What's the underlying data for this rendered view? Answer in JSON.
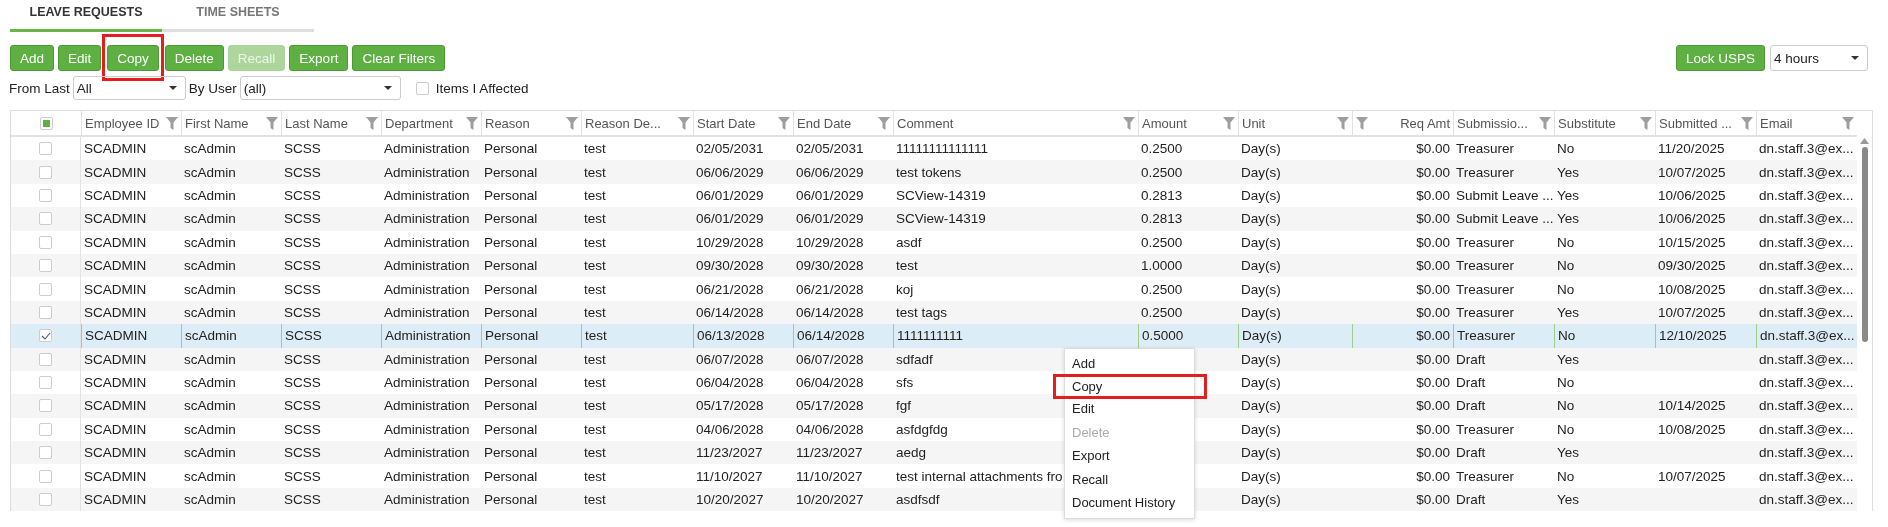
{
  "tabs": [
    {
      "label": "LEAVE REQUESTS",
      "selected": true
    },
    {
      "label": "TIME SHEETS",
      "selected": false
    }
  ],
  "toolbar": {
    "buttons": [
      {
        "label": "Add",
        "disabled": false,
        "highlighted": false
      },
      {
        "label": "Edit",
        "disabled": false,
        "highlighted": false
      },
      {
        "label": "Copy",
        "disabled": false,
        "highlighted": true
      },
      {
        "label": "Delete",
        "disabled": false,
        "highlighted": false
      },
      {
        "label": "Recall",
        "disabled": true,
        "highlighted": false
      },
      {
        "label": "Export",
        "disabled": false,
        "highlighted": false
      },
      {
        "label": "Clear Filters",
        "disabled": false,
        "highlighted": false
      }
    ],
    "lock_button": "Lock USPS",
    "lock_duration": "4 hours"
  },
  "filters": {
    "from_last_label": "From Last",
    "from_last_value": "All",
    "by_user_label": "By User",
    "by_user_value": "(all)",
    "items_affected": {
      "label": "Items I Affected",
      "checked": false
    }
  },
  "table": {
    "select_all": {
      "indeterminate": true
    },
    "columns": [
      {
        "label": "Employee ID",
        "kind": "text"
      },
      {
        "label": "First Name",
        "kind": "text"
      },
      {
        "label": "Last Name",
        "kind": "text"
      },
      {
        "label": "Department",
        "kind": "text"
      },
      {
        "label": "Reason",
        "kind": "text"
      },
      {
        "label": "Reason De...",
        "kind": "text"
      },
      {
        "label": "Start Date",
        "kind": "text"
      },
      {
        "label": "End Date",
        "kind": "text"
      },
      {
        "label": "Comment",
        "kind": "text"
      },
      {
        "label": "Amount",
        "kind": "text"
      },
      {
        "label": "Unit",
        "kind": "text"
      },
      {
        "label": "Req Amt",
        "kind": "numeric"
      },
      {
        "label": "Submissio...",
        "kind": "text"
      },
      {
        "label": "Substitute",
        "kind": "text"
      },
      {
        "label": "Submitted ...",
        "kind": "text"
      },
      {
        "label": "Email",
        "kind": "text"
      }
    ],
    "rows": [
      {
        "checked": false,
        "selected": false,
        "cells": [
          "SCADMIN",
          "scAdmin",
          "SCSS",
          "Administration",
          "Personal",
          "test",
          "02/05/2031",
          "02/05/2031",
          "11111111111111",
          "0.2500",
          "Day(s)",
          "$0.00",
          "Treasurer",
          "No",
          "11/20/2025",
          "dn.staff.3@ex..."
        ]
      },
      {
        "checked": false,
        "selected": false,
        "cells": [
          "SCADMIN",
          "scAdmin",
          "SCSS",
          "Administration",
          "Personal",
          "test",
          "06/06/2029",
          "06/06/2029",
          "test tokens",
          "0.2500",
          "Day(s)",
          "$0.00",
          "Treasurer",
          "Yes",
          "10/07/2025",
          "dn.staff.3@ex..."
        ]
      },
      {
        "checked": false,
        "selected": false,
        "cells": [
          "SCADMIN",
          "scAdmin",
          "SCSS",
          "Administration",
          "Personal",
          "test",
          "06/01/2029",
          "06/01/2029",
          "SCView-14319",
          "0.2813",
          "Day(s)",
          "$0.00",
          "Submit Leave ...",
          "Yes",
          "10/06/2025",
          "dn.staff.3@ex..."
        ]
      },
      {
        "checked": false,
        "selected": false,
        "cells": [
          "SCADMIN",
          "scAdmin",
          "SCSS",
          "Administration",
          "Personal",
          "test",
          "06/01/2029",
          "06/01/2029",
          "SCView-14319",
          "0.2813",
          "Day(s)",
          "$0.00",
          "Submit Leave ...",
          "Yes",
          "10/06/2025",
          "dn.staff.3@ex..."
        ]
      },
      {
        "checked": false,
        "selected": false,
        "cells": [
          "SCADMIN",
          "scAdmin",
          "SCSS",
          "Administration",
          "Personal",
          "test",
          "10/29/2028",
          "10/29/2028",
          "asdf",
          "0.2500",
          "Day(s)",
          "$0.00",
          "Treasurer",
          "No",
          "10/15/2025",
          "dn.staff.3@ex..."
        ]
      },
      {
        "checked": false,
        "selected": false,
        "cells": [
          "SCADMIN",
          "scAdmin",
          "SCSS",
          "Administration",
          "Personal",
          "test",
          "09/30/2028",
          "09/30/2028",
          "test",
          "1.0000",
          "Day(s)",
          "$0.00",
          "Treasurer",
          "No",
          "09/30/2025",
          "dn.staff.3@ex..."
        ]
      },
      {
        "checked": false,
        "selected": false,
        "cells": [
          "SCADMIN",
          "scAdmin",
          "SCSS",
          "Administration",
          "Personal",
          "test",
          "06/21/2028",
          "06/21/2028",
          "koj",
          "0.2500",
          "Day(s)",
          "$0.00",
          "Treasurer",
          "No",
          "10/08/2025",
          "dn.staff.3@ex..."
        ]
      },
      {
        "checked": false,
        "selected": false,
        "cells": [
          "SCADMIN",
          "scAdmin",
          "SCSS",
          "Administration",
          "Personal",
          "test",
          "06/14/2028",
          "06/14/2028",
          "test tags",
          "0.2500",
          "Day(s)",
          "$0.00",
          "Treasurer",
          "Yes",
          "10/07/2025",
          "dn.staff.3@ex..."
        ]
      },
      {
        "checked": true,
        "selected": true,
        "cells": [
          "SCADMIN",
          "scAdmin",
          "SCSS",
          "Administration",
          "Personal",
          "test",
          "06/13/2028",
          "06/14/2028",
          "1111111111",
          "0.5000",
          "Day(s)",
          "$0.00",
          "Treasurer",
          "No",
          "12/10/2025",
          "dn.staff.3@ex..."
        ]
      },
      {
        "checked": false,
        "selected": false,
        "cells": [
          "SCADMIN",
          "scAdmin",
          "SCSS",
          "Administration",
          "Personal",
          "test",
          "06/07/2028",
          "06/07/2028",
          "sdfadf",
          null,
          "Day(s)",
          "$0.00",
          "Draft",
          "Yes",
          null,
          "dn.staff.3@ex..."
        ]
      },
      {
        "checked": false,
        "selected": false,
        "cells": [
          "SCADMIN",
          "scAdmin",
          "SCSS",
          "Administration",
          "Personal",
          "test",
          "06/04/2028",
          "06/04/2028",
          "sfs",
          null,
          "Day(s)",
          "$0.00",
          "Draft",
          "No",
          null,
          "dn.staff.3@ex..."
        ]
      },
      {
        "checked": false,
        "selected": false,
        "cells": [
          "SCADMIN",
          "scAdmin",
          "SCSS",
          "Administration",
          "Personal",
          "test",
          "05/17/2028",
          "05/17/2028",
          "fgf",
          null,
          "Day(s)",
          "$0.00",
          "Draft",
          "No",
          "10/14/2025",
          "dn.staff.3@ex..."
        ]
      },
      {
        "checked": false,
        "selected": false,
        "cells": [
          "SCADMIN",
          "scAdmin",
          "SCSS",
          "Administration",
          "Personal",
          "test",
          "04/06/2028",
          "04/06/2028",
          "asfdgfdg",
          null,
          "Day(s)",
          "$0.00",
          "Treasurer",
          "No",
          "10/08/2025",
          "dn.staff.3@ex..."
        ]
      },
      {
        "checked": false,
        "selected": false,
        "cells": [
          "SCADMIN",
          "scAdmin",
          "SCSS",
          "Administration",
          "Personal",
          "test",
          "11/23/2027",
          "11/23/2027",
          "aedg",
          null,
          "Day(s)",
          "$0.00",
          "Draft",
          "Yes",
          null,
          "dn.staff.3@ex..."
        ]
      },
      {
        "checked": false,
        "selected": false,
        "cells": [
          "SCADMIN",
          "scAdmin",
          "SCSS",
          "Administration",
          "Personal",
          "test",
          "11/10/2027",
          "11/10/2027",
          "test internal attachments fro",
          null,
          "Day(s)",
          "$0.00",
          "Treasurer",
          "No",
          "10/07/2025",
          "dn.staff.3@ex..."
        ]
      },
      {
        "checked": false,
        "selected": false,
        "cells": [
          "SCADMIN",
          "scAdmin",
          "SCSS",
          "Administration",
          "Personal",
          "test",
          "10/20/2027",
          "10/20/2027",
          "asdfsdf",
          null,
          "Day(s)",
          "$0.00",
          "Draft",
          "Yes",
          null,
          "dn.staff.3@ex..."
        ]
      }
    ]
  },
  "context_menu": {
    "items": [
      {
        "label": "Add",
        "disabled": false,
        "highlighted": false
      },
      {
        "label": "Copy",
        "disabled": false,
        "highlighted": true
      },
      {
        "label": "Edit",
        "disabled": false,
        "highlighted": false
      },
      {
        "label": "Delete",
        "disabled": true,
        "highlighted": false
      },
      {
        "label": "Export",
        "disabled": false,
        "highlighted": false
      },
      {
        "label": "Recall",
        "disabled": false,
        "highlighted": false
      },
      {
        "label": "Document History",
        "disabled": false,
        "highlighted": false
      }
    ]
  }
}
